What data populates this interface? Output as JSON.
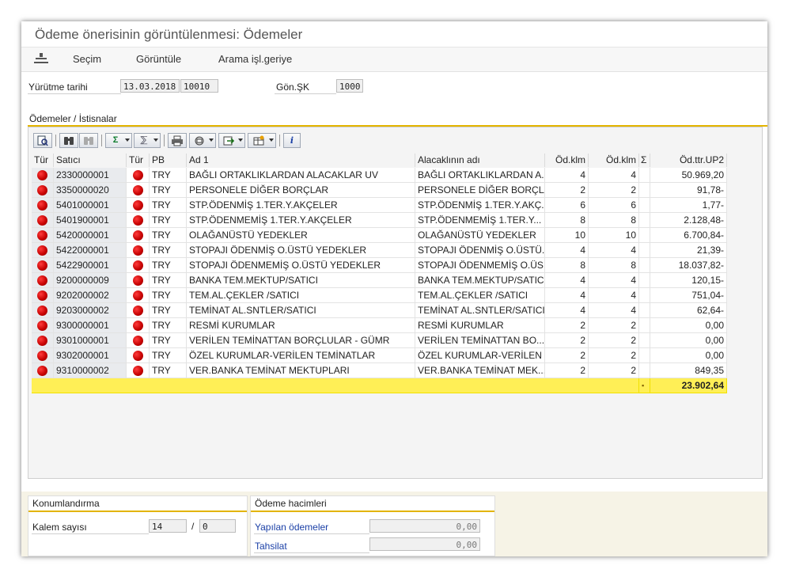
{
  "title": "Ödeme önerisinin görüntülenmesi: Ödemeler",
  "menu": {
    "icon": "menu-icon",
    "items": [
      "Seçim",
      "Görüntüle",
      "Arama işl.geriye"
    ]
  },
  "header": {
    "exec_date_label": "Yürütme tarihi",
    "exec_date_value": "13.03.2018",
    "exec_id_value": "10010",
    "sender_cc_label": "Gön.ŞK",
    "sender_cc_value": "1000"
  },
  "tab_label": "Ödemeler / İstisnalar",
  "toolbar": [
    "details-icon",
    "find-icon",
    "find-next-icon",
    "sum-icon",
    "subtotal-icon",
    "print-icon",
    "views-icon",
    "export-icon",
    "layout-icon",
    "info-icon"
  ],
  "toolbar_labels": {
    "sum": "Σ",
    "subtotal": "⅀",
    "info": "i"
  },
  "columns": [
    "Tür",
    "Satıcı",
    "Tür",
    "PB",
    "Ad 1",
    "Alacaklının adı",
    "Öd.klm",
    "Öd.klm",
    "Σ",
    "Öd.ttr.UP2"
  ],
  "rows": [
    {
      "vendor": "2330000001",
      "cur": "TRY",
      "name1": "BAĞLI ORTAKLIKLARDAN ALACAKLAR UV",
      "payee": "BAĞLI ORTAKLIKLARDAN A...",
      "items1": "4",
      "items2": "4",
      "amount": "50.969,20"
    },
    {
      "vendor": "3350000020",
      "cur": "TRY",
      "name1": "PERSONELE DİĞER BORÇLAR",
      "payee": "PERSONELE DİĞER BORÇLAR",
      "items1": "2",
      "items2": "2",
      "amount": "91,78-"
    },
    {
      "vendor": "5401000001",
      "cur": "TRY",
      "name1": "STP.ÖDENMİŞ 1.TER.Y.AKÇELER",
      "payee": "STP.ÖDENMİŞ 1.TER.Y.AKÇ...",
      "items1": "6",
      "items2": "6",
      "amount": "1,77-"
    },
    {
      "vendor": "5401900001",
      "cur": "TRY",
      "name1": "STP.ÖDENMEMİŞ 1.TER.Y.AKÇELER",
      "payee": "STP.ÖDENMEMİŞ 1.TER.Y...",
      "items1": "8",
      "items2": "8",
      "amount": "2.128,48-"
    },
    {
      "vendor": "5420000001",
      "cur": "TRY",
      "name1": "OLAĞANÜSTÜ YEDEKLER",
      "payee": "OLAĞANÜSTÜ YEDEKLER",
      "items1": "10",
      "items2": "10",
      "amount": "6.700,84-"
    },
    {
      "vendor": "5422000001",
      "cur": "TRY",
      "name1": "STOPAJI ÖDENMİŞ O.ÜSTÜ YEDEKLER",
      "payee": "STOPAJI ÖDENMİŞ O.ÜSTÜ...",
      "items1": "4",
      "items2": "4",
      "amount": "21,39-"
    },
    {
      "vendor": "5422900001",
      "cur": "TRY",
      "name1": "STOPAJI ÖDENMEMİŞ O.ÜSTÜ YEDEKLER",
      "payee": "STOPAJI ÖDENMEMİŞ O.ÜS...",
      "items1": "8",
      "items2": "8",
      "amount": "18.037,82-"
    },
    {
      "vendor": "9200000009",
      "cur": "TRY",
      "name1": "BANKA TEM.MEKTUP/SATICI",
      "payee": "BANKA TEM.MEKTUP/SATICI",
      "items1": "4",
      "items2": "4",
      "amount": "120,15-"
    },
    {
      "vendor": "9202000002",
      "cur": "TRY",
      "name1": "TEM.AL.ÇEKLER /SATICI",
      "payee": "TEM.AL.ÇEKLER /SATICI",
      "items1": "4",
      "items2": "4",
      "amount": "751,04-"
    },
    {
      "vendor": "9203000002",
      "cur": "TRY",
      "name1": "TEMİNAT AL.SNTLER/SATICI",
      "payee": "TEMİNAT AL.SNTLER/SATICI",
      "items1": "4",
      "items2": "4",
      "amount": "62,64-"
    },
    {
      "vendor": "9300000001",
      "cur": "TRY",
      "name1": "RESMİ KURUMLAR",
      "payee": "RESMİ KURUMLAR",
      "items1": "2",
      "items2": "2",
      "amount": "0,00"
    },
    {
      "vendor": "9301000001",
      "cur": "TRY",
      "name1": "VERİLEN TEMİNATTAN BORÇLULAR - GÜMR",
      "payee": "VERİLEN TEMİNATTAN BO...",
      "items1": "2",
      "items2": "2",
      "amount": "0,00"
    },
    {
      "vendor": "9302000001",
      "cur": "TRY",
      "name1": "ÖZEL KURUMLAR-VERİLEN TEMİNATLAR",
      "payee": "ÖZEL KURUMLAR-VERİLEN ...",
      "items1": "2",
      "items2": "2",
      "amount": "0,00"
    },
    {
      "vendor": "9310000002",
      "cur": "TRY",
      "name1": "VER.BANKA TEMİNAT MEKTUPLARI",
      "payee": "VER.BANKA TEMİNAT MEK...",
      "items1": "2",
      "items2": "2",
      "amount": "849,35"
    }
  ],
  "total": {
    "marker": "▪",
    "amount": "23.902,64"
  },
  "status_color": "#d40000",
  "total_color": "#ffef56",
  "positioning": {
    "title": "Konumlandırma",
    "item_count_label": "Kalem sayısı",
    "item_count_value": "14",
    "separator": "/",
    "item_count_value2": "0"
  },
  "volumes": {
    "title": "Ödeme hacimleri",
    "payments_label": "Yapılan ödemeler",
    "payments_value": "0,00",
    "collections_label": "Tahsilat",
    "collections_value": "0,00"
  }
}
